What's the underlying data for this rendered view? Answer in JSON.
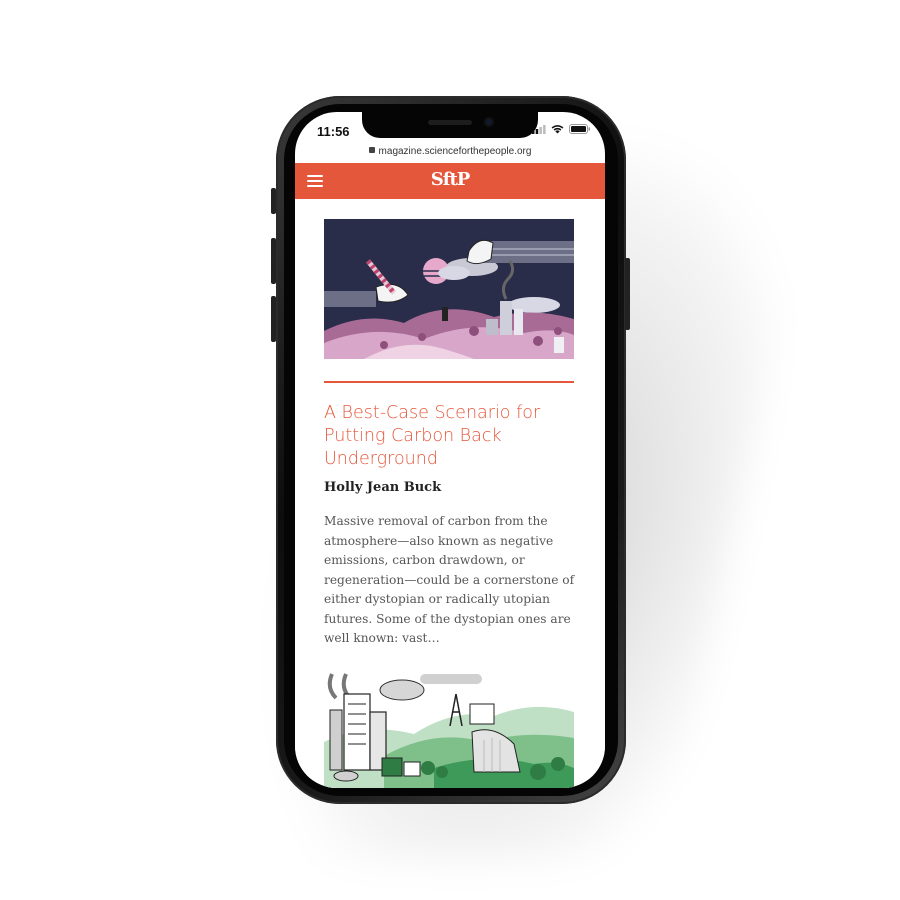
{
  "status_bar": {
    "time": "11:56"
  },
  "browser": {
    "url": "magazine.scienceforthepeople.org"
  },
  "header": {
    "logo": "SftP",
    "accent_color": "#e5573b",
    "menu_icon": "hamburger-menu-icon"
  },
  "article": {
    "title": "A Best-Case Scenario for Putting Carbon Back Underground",
    "author": "Holly Jean Buck",
    "excerpt": "Massive removal of carbon from the atmosphere—also known as negative emissions, carbon drawdown, or regeneration—could be a cornerstone of either dystopian or radically utopian futures. Some of the dystopian ones are well known: vast…"
  }
}
